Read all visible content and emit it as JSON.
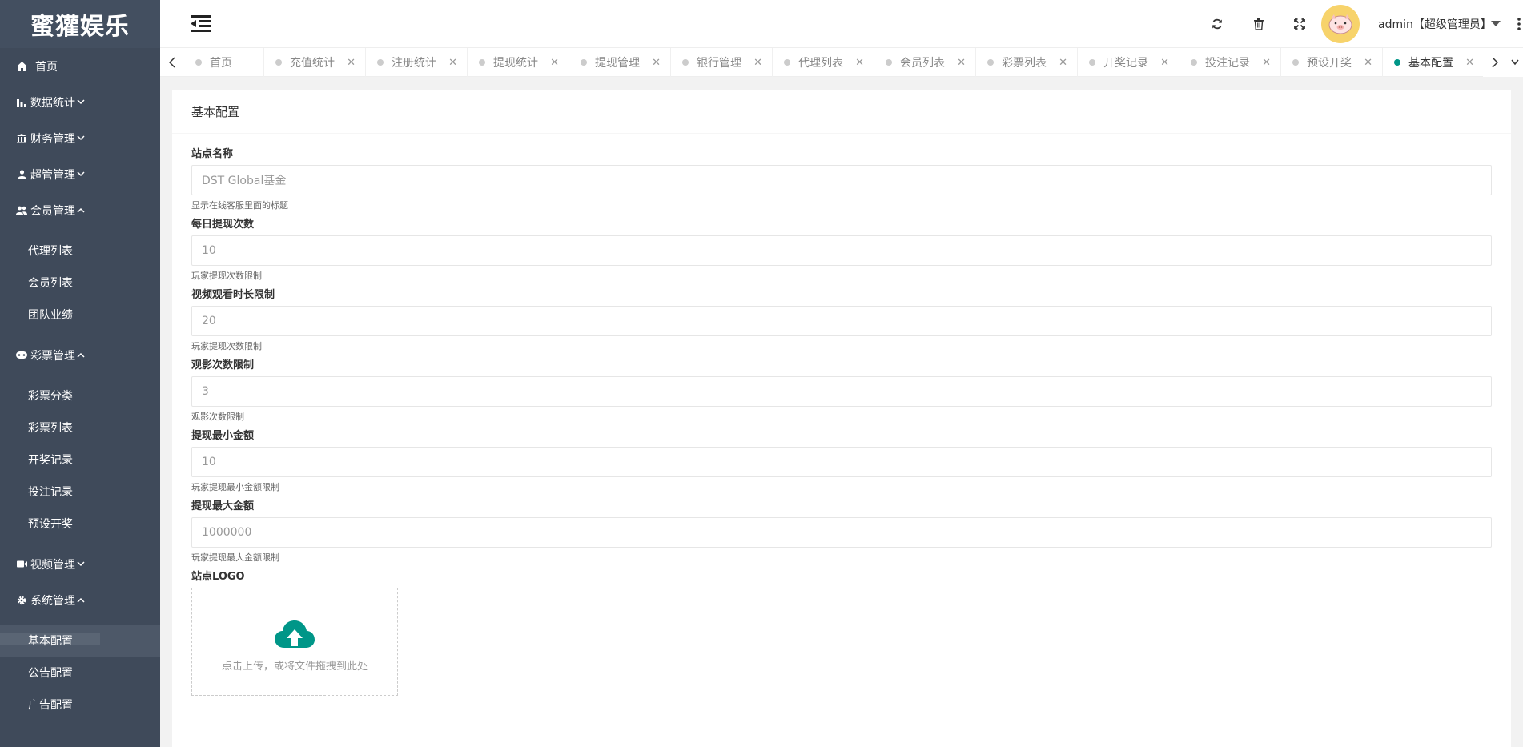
{
  "app": {
    "logo": "蜜獾娱乐"
  },
  "sidebar": {
    "items": [
      {
        "label": "首页",
        "icon": "home-icon"
      },
      {
        "label": "数据统计",
        "icon": "bar-chart-icon",
        "expanded": false
      },
      {
        "label": "财务管理",
        "icon": "bank-icon",
        "expanded": false
      },
      {
        "label": "超管管理",
        "icon": "user-icon",
        "expanded": false
      },
      {
        "label": "会员管理",
        "icon": "users-icon",
        "expanded": true,
        "children": [
          "代理列表",
          "会员列表",
          "团队业绩"
        ]
      },
      {
        "label": "彩票管理",
        "icon": "gamepad-icon",
        "expanded": true,
        "children": [
          "彩票分类",
          "彩票列表",
          "开奖记录",
          "投注记录",
          "预设开奖"
        ]
      },
      {
        "label": "视频管理",
        "icon": "video-icon",
        "expanded": false
      },
      {
        "label": "系统管理",
        "icon": "gear-icon",
        "expanded": true,
        "children": [
          "基本配置",
          "公告配置",
          "广告配置"
        ]
      }
    ],
    "active_child": "基本配置"
  },
  "header": {
    "icons": [
      "menu-toggle-icon",
      "refresh-icon",
      "trash-icon",
      "fullscreen-icon"
    ],
    "username": "admin【超级管理员】"
  },
  "tabs": [
    {
      "label": "首页",
      "closable": false
    },
    {
      "label": "充值统计",
      "closable": true
    },
    {
      "label": "注册统计",
      "closable": true
    },
    {
      "label": "提现统计",
      "closable": true
    },
    {
      "label": "提现管理",
      "closable": true
    },
    {
      "label": "银行管理",
      "closable": true
    },
    {
      "label": "代理列表",
      "closable": true
    },
    {
      "label": "会员列表",
      "closable": true
    },
    {
      "label": "彩票列表",
      "closable": true
    },
    {
      "label": "开奖记录",
      "closable": true
    },
    {
      "label": "投注记录",
      "closable": true
    },
    {
      "label": "预设开奖",
      "closable": true
    },
    {
      "label": "基本配置",
      "closable": true,
      "active": true
    }
  ],
  "card": {
    "title": "基本配置",
    "fields": [
      {
        "label": "站点名称",
        "value": "DST Global基金",
        "help": "显示在线客服里面的标题"
      },
      {
        "label": "每日提现次数",
        "value": "10",
        "help": "玩家提现次数限制"
      },
      {
        "label": "视频观看时长限制",
        "value": "20",
        "help": "玩家提现次数限制"
      },
      {
        "label": "观影次数限制",
        "value": "3",
        "help": "观影次数限制"
      },
      {
        "label": "提现最小金额",
        "value": "10",
        "help": "玩家提现最小金额限制"
      },
      {
        "label": "提现最大金额",
        "value": "1000000",
        "help": "玩家提现最大金额限制"
      }
    ],
    "logo_label": "站点LOGO",
    "upload_text": "点击上传，或将文件拖拽到此处"
  },
  "colors": {
    "sidebar_bg": "#3f4a5a",
    "accent": "#009688",
    "avatar_bg": "#f7d36b"
  }
}
